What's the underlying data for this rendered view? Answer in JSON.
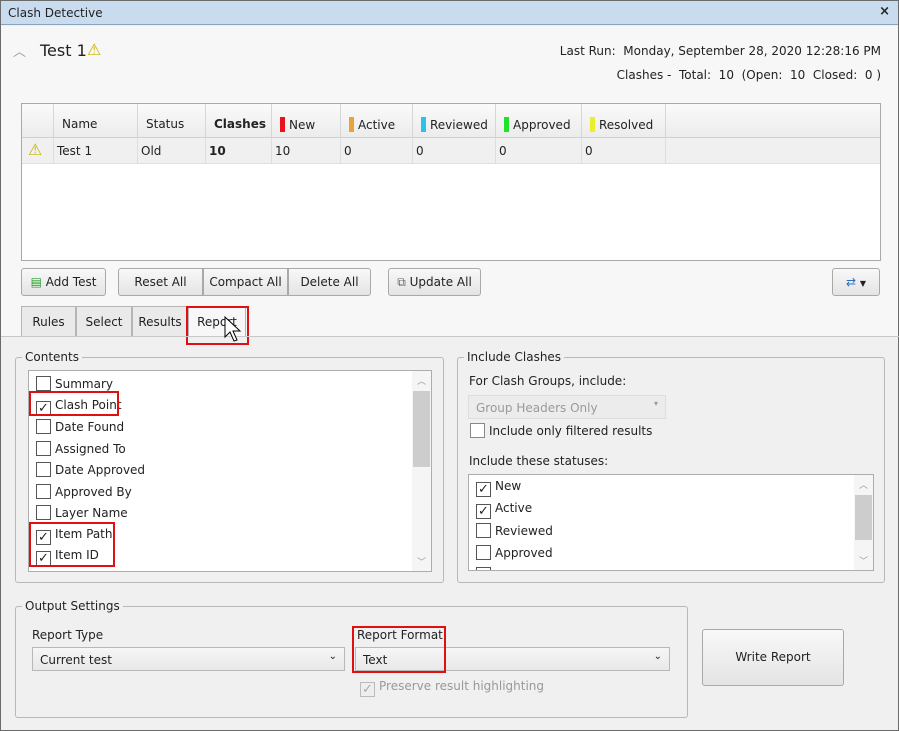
{
  "window": {
    "title": "Clash Detective",
    "close": "×"
  },
  "header": {
    "test_name": "Test 1",
    "last_run_label": "Last Run:",
    "last_run": "Monday, September 28, 2020 12:28:16 PM",
    "summary": "Clashes -  Total:  10  (Open:  10  Closed:  0 )"
  },
  "table": {
    "columns": [
      {
        "label": "Name"
      },
      {
        "label": "Status"
      },
      {
        "label": "Clashes"
      },
      {
        "label": "New",
        "color": "#e8141c"
      },
      {
        "label": "Active",
        "color": "#e9a33a"
      },
      {
        "label": "Reviewed",
        "color": "#27c4e8"
      },
      {
        "label": "Approved",
        "color": "#22e12a"
      },
      {
        "label": "Resolved",
        "color": "#e9ef2c"
      }
    ],
    "rows": [
      {
        "name": "Test 1",
        "status": "Old",
        "clashes": "10",
        "new": "10",
        "active": "0",
        "reviewed": "0",
        "approved": "0",
        "resolved": "0"
      }
    ]
  },
  "toolbar": {
    "add_test": "Add Test",
    "reset_all": "Reset All",
    "compact_all": "Compact All",
    "delete_all": "Delete All",
    "update_all": "Update All"
  },
  "tabs": [
    {
      "label": "Rules"
    },
    {
      "label": "Select"
    },
    {
      "label": "Results"
    },
    {
      "label": "Report",
      "selected": true
    }
  ],
  "contents": {
    "title": "Contents",
    "items": [
      {
        "label": "Summary",
        "checked": false
      },
      {
        "label": "Clash Point",
        "checked": true
      },
      {
        "label": "Date Found",
        "checked": false
      },
      {
        "label": "Assigned To",
        "checked": false
      },
      {
        "label": "Date Approved",
        "checked": false
      },
      {
        "label": "Approved By",
        "checked": false
      },
      {
        "label": "Layer Name",
        "checked": false
      },
      {
        "label": "Item Path",
        "checked": true
      },
      {
        "label": "Item ID",
        "checked": true
      }
    ]
  },
  "include_clashes": {
    "title": "Include Clashes",
    "groups_label": "For Clash Groups, include:",
    "groups_value": "Group Headers Only",
    "filtered_label": "Include only filtered results",
    "filtered_checked": false,
    "statuses_label": "Include these statuses:",
    "statuses": [
      {
        "label": "New",
        "checked": true
      },
      {
        "label": "Active",
        "checked": true
      },
      {
        "label": "Reviewed",
        "checked": false
      },
      {
        "label": "Approved",
        "checked": false
      }
    ]
  },
  "output": {
    "title": "Output Settings",
    "report_type_label": "Report Type",
    "report_type": "Current test",
    "report_format_label": "Report Format",
    "report_format": "Text",
    "preserve_label": "Preserve result highlighting",
    "preserve_checked": true,
    "write_report": "Write Report"
  }
}
